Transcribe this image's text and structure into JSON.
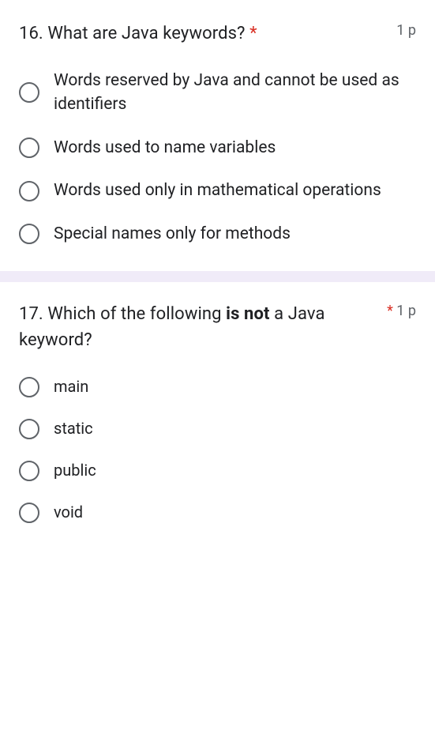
{
  "questions": [
    {
      "number": "16.",
      "title_before": "What are Java keywords?",
      "title_bold": "",
      "title_after": "",
      "required_mark": "*",
      "points": "1 p",
      "options": [
        "Words reserved by Java and cannot be used as identifiers",
        "Words used to name variables",
        "Words used only in mathematical operations",
        "Special names only for methods"
      ]
    },
    {
      "number": "17.",
      "title_before": "Which of the following ",
      "title_bold": "is not",
      "title_after": " a Java keyword?",
      "required_mark": "*",
      "points": "1 p",
      "options": [
        "main",
        "static",
        "public",
        "void"
      ]
    }
  ]
}
